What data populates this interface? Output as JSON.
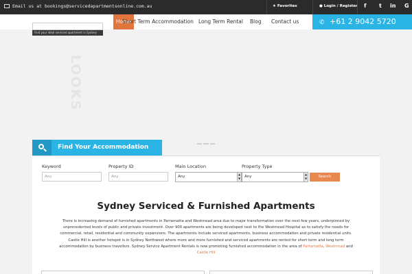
{
  "topbar": {
    "email_text": "Email us at",
    "email_address": "bookings@servicedapartmentsonline.com.au",
    "favorites": "Favorites",
    "login": "Login / Register",
    "social": [
      "f",
      "t",
      "in",
      "G"
    ]
  },
  "nav": {
    "home": "Home",
    "short_term": "Short Term Accommodation",
    "long_term": "Long Term Rental",
    "blog": "Blog",
    "contact": "Contact us",
    "phone": "+61 2 9042 5720"
  },
  "mini_search": {
    "tip": "Find your ideal serviced apartment in Sydney"
  },
  "hero": {
    "word": "LOOKS"
  },
  "find": {
    "title": "Find Your Accommodation"
  },
  "search": {
    "keyword_label": "Keyword",
    "keyword_placeholder": "Any",
    "property_id_label": "Property ID",
    "property_id_placeholder": "Any",
    "main_location_label": "Main Location",
    "main_location_value": "Any",
    "property_type_label": "Property Type",
    "property_type_value": "Any",
    "button": "Search"
  },
  "content": {
    "title": "Sydney Serviced & Furnished Apartments",
    "para_main": "There is increasing demand of furnished apartments in Parramatta and Westmead area due to major transformation over the next few years, underpinned by unprecedented levels of public and private investment. Over 900 apartments are being developed next to the Westmead Hospital as to satisfy the needs for commercial, retail, residential and community expansions. The apartments include serviced apartments, business accommodation and private residential units. Castle Hill is another hotspot is in Sydney Northwest where more and more furnished and serviced apartments are rented for short term and long term accommodation by business travellers. Sydney Service Apartment Rentals is now promoting furnished accommodation in the area of",
    "link1": "Parramatta",
    "link2": "Westmead",
    "and_text": "and",
    "link3": "Castle Hill"
  }
}
